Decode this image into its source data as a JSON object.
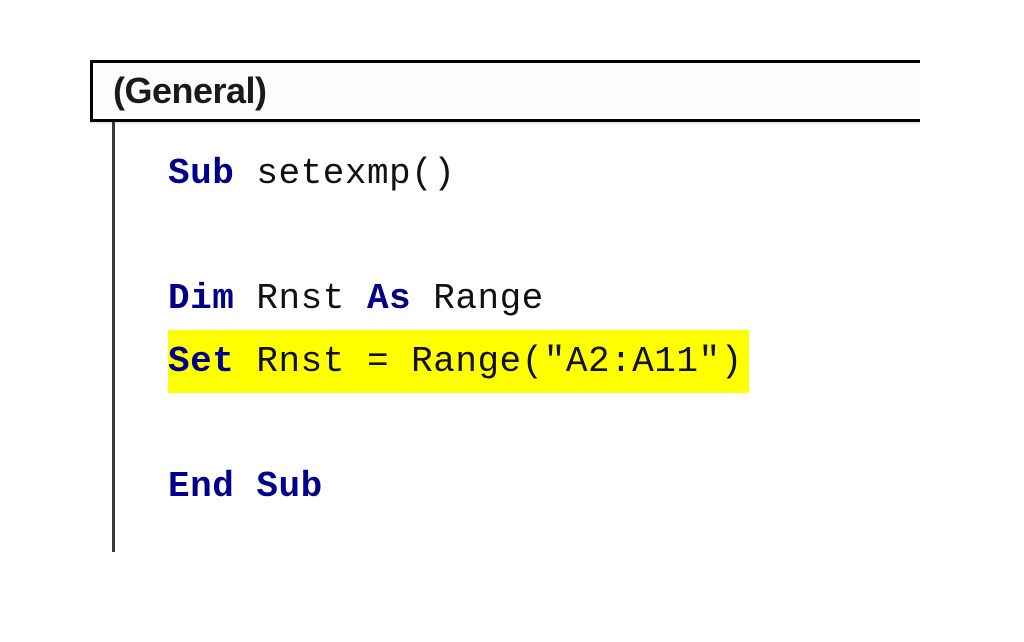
{
  "dropdown": {
    "scope_label": "(General)"
  },
  "code": {
    "line1": {
      "kw": "Sub ",
      "name": "setexmp()"
    },
    "line2": {
      "kw1": "Dim ",
      "name": "Rnst ",
      "kw2": "As ",
      "type": "Range"
    },
    "line3": {
      "kw": "Set ",
      "rest": "Rnst = Range(\"A2:A11\")"
    },
    "line4": {
      "kw": "End Sub"
    }
  }
}
